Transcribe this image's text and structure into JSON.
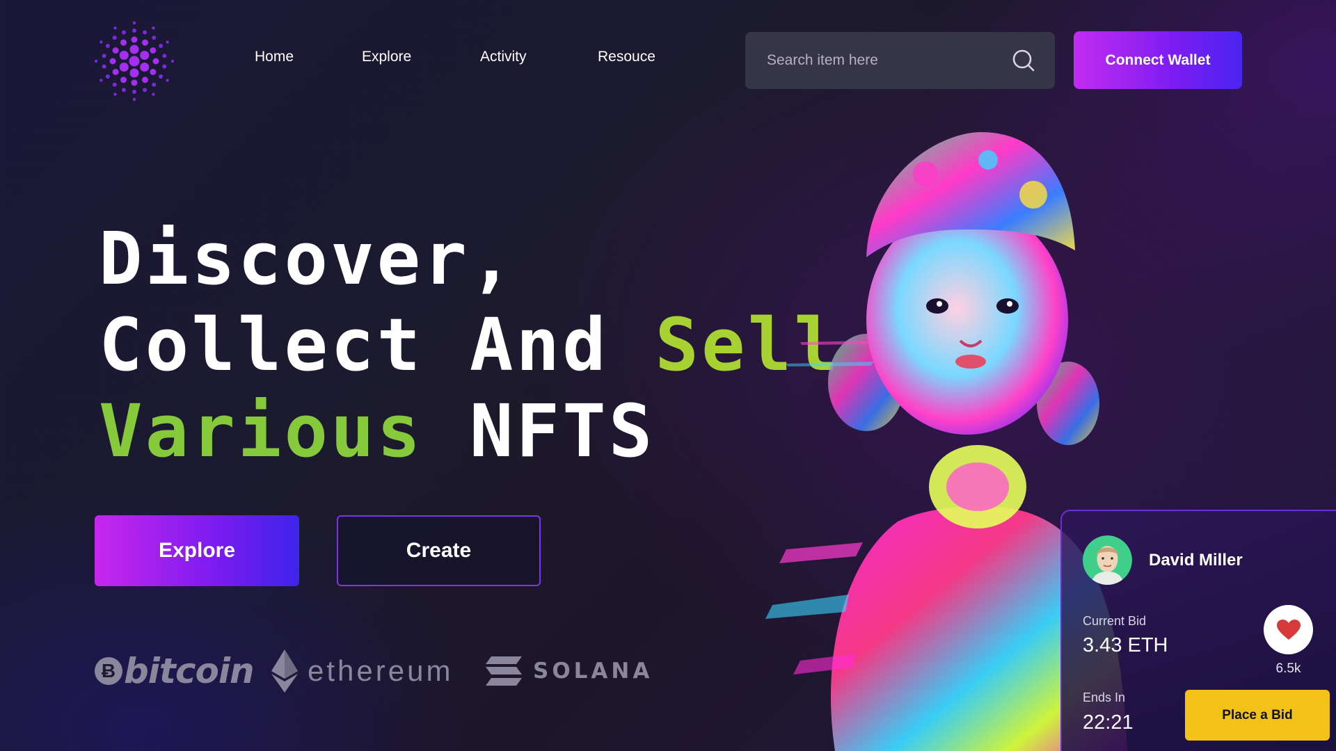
{
  "nav": {
    "items": [
      {
        "label": "Home"
      },
      {
        "label": "Explore"
      },
      {
        "label": "Activity"
      },
      {
        "label": "Resouce"
      }
    ]
  },
  "search": {
    "placeholder": "Search item here",
    "icon": "search-icon"
  },
  "header": {
    "connect_wallet_label": "Connect Wallet"
  },
  "hero": {
    "line1": "Discover,",
    "line2_white": "Collect And ",
    "line2_accent": "Sell",
    "line3_accent": "Various",
    "line3_white": " NFTS"
  },
  "cta": {
    "explore_label": "Explore",
    "create_label": "Create"
  },
  "crypto": {
    "bitcoin_glyph": "Ƀ",
    "bitcoin": "bitcoin",
    "ethereum": "ethereum",
    "solana": "SOLANA"
  },
  "bid_card": {
    "owner_name": "David Miller",
    "current_bid_label": "Current Bid",
    "current_bid_value": "3.43 ETH",
    "likes": "6.5k",
    "ends_in_label": "Ends In",
    "ends_in_value": "22:21",
    "place_bid_label": "Place a Bid"
  },
  "colors": {
    "brand_gradient_start": "#c22cf0",
    "brand_gradient_end": "#4a25f0",
    "accent_lime": "#a8d232",
    "bid_button": "#f2c21a",
    "heart": "#d63a3a"
  }
}
